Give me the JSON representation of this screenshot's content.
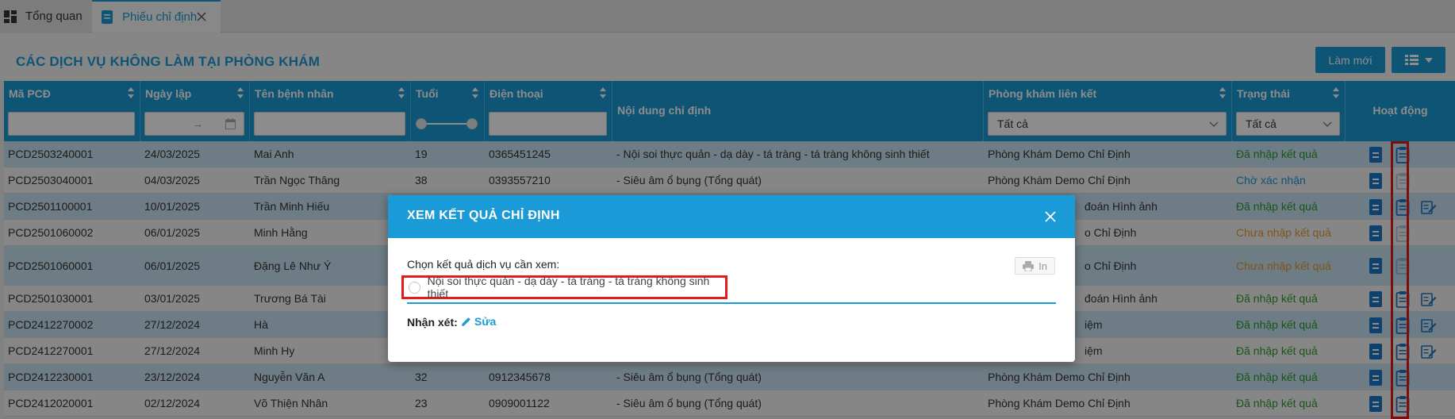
{
  "tabs": [
    {
      "label": "Tổng quan",
      "icon": "dashboard-icon"
    },
    {
      "label": "Phiếu chỉ định",
      "icon": "document-icon",
      "active": true
    }
  ],
  "header": {
    "title": "CÁC DỊCH VỤ KHÔNG LÀM TẠI PHÒNG KHÁM",
    "refresh_label": "Làm mới"
  },
  "columns": {
    "code": "Mã PCĐ",
    "date": "Ngày lập",
    "patient": "Tên bệnh nhân",
    "age": "Tuổi",
    "phone": "Điện thoại",
    "content": "Nội dung chỉ định",
    "clinic": "Phòng khám liên kết",
    "status": "Trạng thái",
    "actions": "Hoạt động"
  },
  "filters": {
    "date_arrow": "→",
    "clinic_value": "Tất cả",
    "status_value": "Tất cả"
  },
  "rows": [
    {
      "code": "PCD2503240001",
      "date": "24/03/2025",
      "patient": "Mai Anh",
      "age": "19",
      "phone": "0365451245",
      "content": "- Nội soi thực quản - dạ dày - tá tràng - tá tràng không sinh thiết",
      "clinic": "Phòng Khám Demo Chỉ Định",
      "status": "Đã nhập kết quả"
    },
    {
      "code": "PCD2503040001",
      "date": "04/03/2025",
      "patient": "Trần Ngọc Thâng",
      "age": "38",
      "phone": "0393557210",
      "content": "- Siêu âm ổ bụng (Tổng quát)",
      "clinic": "Phòng Khám Demo Chỉ Định",
      "status": "Chờ xác nhận"
    },
    {
      "code": "PCD2501100001",
      "date": "10/01/2025",
      "patient": "Trần Minh Hiếu",
      "age": "",
      "phone": "",
      "content": "",
      "clinic": "đoán Hình ảnh",
      "status": "Đã nhập kết quả"
    },
    {
      "code": "PCD2501060002",
      "date": "06/01/2025",
      "patient": "Minh Hằng",
      "age": "",
      "phone": "",
      "content": "",
      "clinic": "o Chỉ Định",
      "status": "Chưa nhập kết quả"
    },
    {
      "code": "PCD2501060001",
      "date": "06/01/2025",
      "patient": "Đặng Lê Như Ý",
      "age": "",
      "phone": "",
      "content": "",
      "clinic": "o Chỉ Định",
      "status": "Chưa nhập kết quả"
    },
    {
      "code": "PCD2501030001",
      "date": "03/01/2025",
      "patient": "Trương Bá Tài",
      "age": "",
      "phone": "",
      "content": "",
      "clinic": "đoán Hình ảnh",
      "status": "Đã nhập kết quả"
    },
    {
      "code": "PCD2412270002",
      "date": "27/12/2024",
      "patient": "Hà",
      "age": "",
      "phone": "",
      "content": "",
      "clinic": "iệm",
      "status": "Đã nhập kết quả"
    },
    {
      "code": "PCD2412270001",
      "date": "27/12/2024",
      "patient": "Minh Hy",
      "age": "",
      "phone": "",
      "content": "",
      "clinic": "iệm",
      "status": "Đã nhập kết quả"
    },
    {
      "code": "PCD2412230001",
      "date": "23/12/2024",
      "patient": "Nguyễn Văn A",
      "age": "32",
      "phone": "0912345678",
      "content": "- Siêu âm ổ bụng (Tổng quát)",
      "clinic": "Phòng Khám Demo Chỉ Định",
      "status": "Đã nhập kết quả"
    },
    {
      "code": "PCD2412020001",
      "date": "02/12/2024",
      "patient": "Võ Thiện Nhân",
      "age": "23",
      "phone": "0909001122",
      "content": "- Siêu âm ổ bụng (Tổng quát)",
      "clinic": "Phòng Khám Demo Chỉ Định",
      "status": "Đã nhập kết quả"
    }
  ],
  "modal": {
    "title": "XEM KẾT QUẢ CHỈ ĐỊNH",
    "choose_label": "Chọn kết quả dịch vụ cần xem:",
    "print_label": "In",
    "option_label": "Nội soi thực quản - dạ dày - tá tràng - tá tràng không sinh thiết",
    "comment_label": "Nhận xét:",
    "edit_label": "Sửa"
  },
  "colors": {
    "primary": "#1a9ad6",
    "status_done": "#2e9c2e",
    "status_waiting": "#1a9ad6",
    "status_pending": "#e39a2e",
    "highlight": "#e21b1b"
  }
}
